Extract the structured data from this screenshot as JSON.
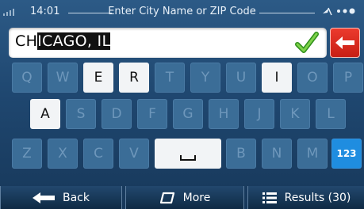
{
  "statusbar": {
    "time": "14:01",
    "title": "Enter City Name or ZIP Code"
  },
  "search": {
    "typed": "CH",
    "suggestion": "ICAGO, IL"
  },
  "keyboard": {
    "row1": [
      "Q",
      "W",
      "E",
      "R",
      "T",
      "Y",
      "U",
      "I",
      "O",
      "P"
    ],
    "row2": [
      "A",
      "S",
      "D",
      "F",
      "G",
      "H",
      "J",
      "K",
      "L"
    ],
    "row3_left": [
      "Z",
      "X",
      "C",
      "V"
    ],
    "row3_right": [
      "B",
      "N",
      "M"
    ],
    "num_label": "123",
    "enabled": [
      "E",
      "R",
      "I",
      "A"
    ]
  },
  "bottombar": {
    "back_label": "Back",
    "more_label": "More",
    "results_label": "Results (30)"
  },
  "colors": {
    "background": "#1f4770",
    "key_disabled": "#3b6d97",
    "key_enabled": "#f2f4f6",
    "backspace": "#e0281d",
    "num_key": "#1f8de0"
  }
}
